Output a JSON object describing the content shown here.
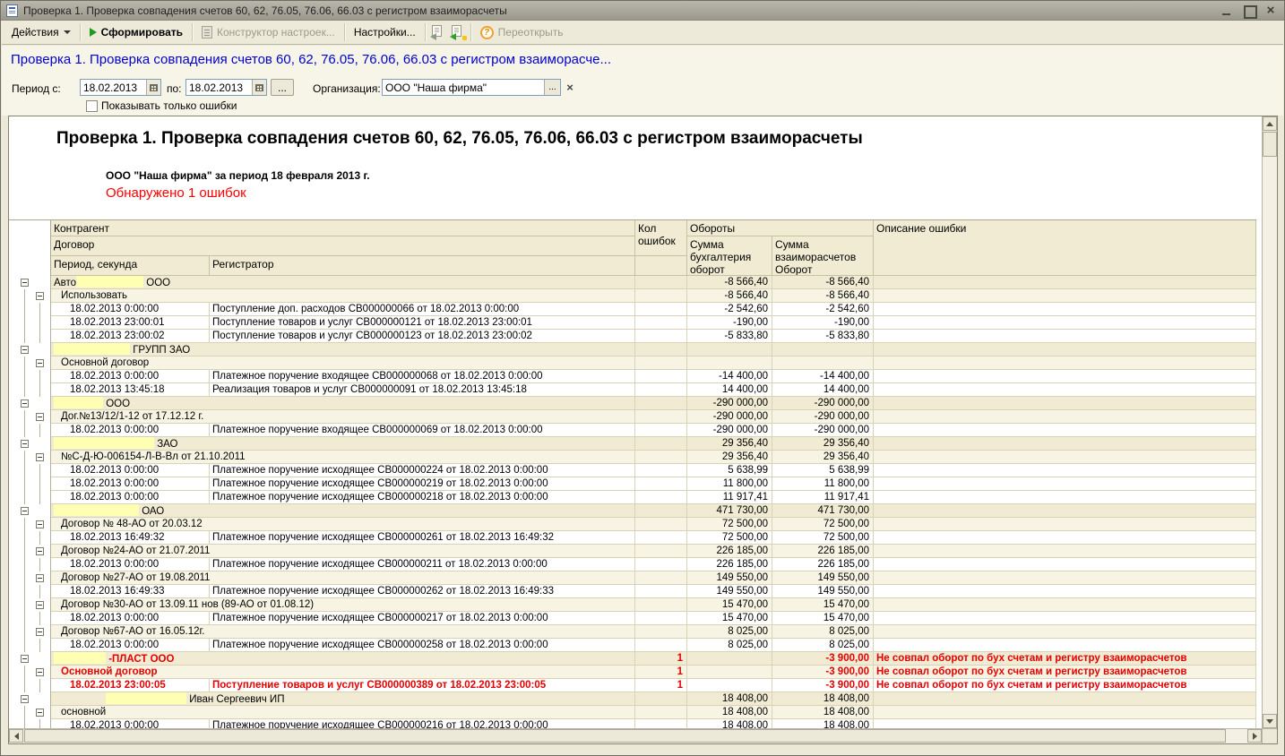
{
  "window": {
    "title": "Проверка 1. Проверка совпадения счетов 60, 62, 76.05, 76.06, 66.03  с регистром взаиморасчеты"
  },
  "toolbar": {
    "actions": "Действия",
    "generate": "Сформировать",
    "constructor": "Конструктор настроек...",
    "settings": "Настройки...",
    "help": "?",
    "reopen": "Переоткрыть"
  },
  "form": {
    "heading": "Проверка 1. Проверка совпадения счетов 60, 62, 76.05, 76.06, 66.03  с регистром взаиморасче...",
    "period_label": "Период с:",
    "period_from": "18.02.2013",
    "to_label": "по:",
    "period_to": "18.02.2013",
    "more_button": "...",
    "org_label": "Организация:",
    "org_value": "ООО \"Наша фирма\"",
    "org_more": "...",
    "org_clear": "×",
    "checkbox_label": "Показывать только ошибки",
    "checkbox_checked": false
  },
  "report": {
    "title": "Проверка 1. Проверка совпадения счетов 60, 62, 76.05, 76.06, 66.03  с регистром взаиморасчеты",
    "subtitle": "ООО \"Наша фирма\" за период 18 февраля 2013 г.",
    "error_summary": "Обнаружено 1 ошибок"
  },
  "colors": {
    "heading_blue": "#0000d4",
    "error_red": "#e60000",
    "highlight_yellow": "#ffffb4",
    "group1_bg": "#f0ebd2",
    "group2_bg": "#f7f4e3"
  },
  "table": {
    "headers": {
      "contragent": "Контрагент",
      "contract": "Договор",
      "period": "Период, секунда",
      "registrar": "Регистратор",
      "err_count": "Кол ошибок",
      "turnovers": "Обороты",
      "sum_accounting": "Сумма бухгалтерия оборот",
      "sum_settlements": "Сумма взаиморасчетов Оборот",
      "err_desc": "Описание ошибки"
    },
    "rows": [
      {
        "t": "g1",
        "l1": "box",
        "pre": "Авто",
        "hl": 75,
        "text": "ООО",
        "s1": "-8 566,40",
        "s2": "-8 566,40"
      },
      {
        "t": "g2",
        "l1": "line",
        "l2": "box",
        "text": "Использовать",
        "s1": "-8 566,40",
        "s2": "-8 566,40"
      },
      {
        "t": "d",
        "l1": "line",
        "l2": "line",
        "date": "18.02.2013 0:00:00",
        "reg": "Поступление доп. расходов СВ000000066 от 18.02.2013 0:00:00",
        "s1": "-2 542,60",
        "s2": "-2 542,60"
      },
      {
        "t": "d",
        "l1": "line",
        "l2": "line",
        "date": "18.02.2013 23:00:01",
        "reg": "Поступление товаров и услуг СВ000000121 от 18.02.2013 23:00:01",
        "s1": "-190,00",
        "s2": "-190,00"
      },
      {
        "t": "d",
        "l1": "line",
        "l2": "line",
        "date": "18.02.2013 23:00:02",
        "reg": "Поступление товаров и услуг СВ000000123 от 18.02.2013 23:00:02",
        "s1": "-5 833,80",
        "s2": "-5 833,80"
      },
      {
        "t": "g1",
        "l1": "box",
        "hl": 85,
        "text": "ГРУПП ЗАО",
        "s1": "",
        "s2": ""
      },
      {
        "t": "g2",
        "l1": "line",
        "l2": "box",
        "text": "Основной договор",
        "s1": "",
        "s2": ""
      },
      {
        "t": "d",
        "l1": "line",
        "l2": "line",
        "date": "18.02.2013 0:00:00",
        "reg": "Платежное поручение входящее СВ000000068 от 18.02.2013 0:00:00",
        "s1": "-14 400,00",
        "s2": "-14 400,00"
      },
      {
        "t": "d",
        "l1": "line",
        "l2": "line",
        "date": "18.02.2013 13:45:18",
        "reg": "Реализация товаров и услуг СВ000000091 от 18.02.2013 13:45:18",
        "s1": "14 400,00",
        "s2": "14 400,00"
      },
      {
        "t": "g1",
        "l1": "box",
        "hl": 55,
        "text": "ООО",
        "s1": "-290 000,00",
        "s2": "-290 000,00"
      },
      {
        "t": "g2",
        "l1": "line",
        "l2": "box",
        "text": "Дог.№13/12/1-12 от 17.12.12 г.",
        "s1": "-290 000,00",
        "s2": "-290 000,00"
      },
      {
        "t": "d",
        "l1": "line",
        "l2": "line",
        "date": "18.02.2013 0:00:00",
        "reg": "Платежное поручение входящее СВ000000069 от 18.02.2013 0:00:00",
        "s1": "-290 000,00",
        "s2": "-290 000,00"
      },
      {
        "t": "g1",
        "l1": "box",
        "hl": 112,
        "text": "ЗАО",
        "s1": "29 356,40",
        "s2": "29 356,40"
      },
      {
        "t": "g2",
        "l1": "line",
        "l2": "box",
        "text": "№С-Д-Ю-006154-Л-В-Вл от 21.10.2011",
        "s1": "29 356,40",
        "s2": "29 356,40"
      },
      {
        "t": "d",
        "l1": "line",
        "l2": "line",
        "date": "18.02.2013 0:00:00",
        "reg": "Платежное поручение исходящее СВ000000224 от 18.02.2013 0:00:00",
        "s1": "5 638,99",
        "s2": "5 638,99"
      },
      {
        "t": "d",
        "l1": "line",
        "l2": "line",
        "date": "18.02.2013 0:00:00",
        "reg": "Платежное поручение исходящее СВ000000219 от 18.02.2013 0:00:00",
        "s1": "11 800,00",
        "s2": "11 800,00"
      },
      {
        "t": "d",
        "l1": "line",
        "l2": "line",
        "date": "18.02.2013 0:00:00",
        "reg": "Платежное поручение исходящее СВ000000218 от 18.02.2013 0:00:00",
        "s1": "11 917,41",
        "s2": "11 917,41"
      },
      {
        "t": "g1",
        "l1": "box",
        "hl": 95,
        "text": "ОАО",
        "s1": "471 730,00",
        "s2": "471 730,00"
      },
      {
        "t": "g2",
        "l1": "line",
        "l2": "box",
        "text": "Договор № 48-АО от 20.03.12",
        "s1": "72 500,00",
        "s2": "72 500,00"
      },
      {
        "t": "d",
        "l1": "line",
        "l2": "line",
        "date": "18.02.2013 16:49:32",
        "reg": "Платежное поручение исходящее СВ000000261 от 18.02.2013 16:49:32",
        "s1": "72 500,00",
        "s2": "72 500,00"
      },
      {
        "t": "g2",
        "l1": "line",
        "l2": "box",
        "text": "Договор №24-АО от 21.07.2011",
        "s1": "226 185,00",
        "s2": "226 185,00"
      },
      {
        "t": "d",
        "l1": "line",
        "l2": "line",
        "date": "18.02.2013 0:00:00",
        "reg": "Платежное поручение исходящее СВ000000211 от 18.02.2013 0:00:00",
        "s1": "226 185,00",
        "s2": "226 185,00"
      },
      {
        "t": "g2",
        "l1": "line",
        "l2": "box",
        "text": "Договор №27-АО от 19.08.2011",
        "s1": "149 550,00",
        "s2": "149 550,00"
      },
      {
        "t": "d",
        "l1": "line",
        "l2": "line",
        "date": "18.02.2013 16:49:33",
        "reg": "Платежное поручение исходящее СВ000000262 от 18.02.2013 16:49:33",
        "s1": "149 550,00",
        "s2": "149 550,00"
      },
      {
        "t": "g2",
        "l1": "line",
        "l2": "box",
        "text": "Договор №30-АО от 13.09.11 нов (89-АО от 01.08.12)",
        "s1": "15 470,00",
        "s2": "15 470,00"
      },
      {
        "t": "d",
        "l1": "line",
        "l2": "line",
        "date": "18.02.2013 0:00:00",
        "reg": "Платежное поручение исходящее СВ000000217 от 18.02.2013 0:00:00",
        "s1": "15 470,00",
        "s2": "15 470,00"
      },
      {
        "t": "g2",
        "l1": "line",
        "l2": "box",
        "text": "Договор №67-АО от 16.05.12г.",
        "s1": "8 025,00",
        "s2": "8 025,00"
      },
      {
        "t": "d",
        "l1": "line",
        "l2": "line",
        "date": "18.02.2013 0:00:00",
        "reg": "Платежное поручение исходящее СВ000000258 от 18.02.2013 0:00:00",
        "s1": "8 025,00",
        "s2": "8 025,00"
      },
      {
        "t": "g1",
        "l1": "box",
        "hl": 58,
        "text": "-ПЛАСТ ООО",
        "red": true,
        "kol": "1",
        "s1": "",
        "s2": "-3 900,00",
        "desc": "Не совпал оборот по бух счетам и регистру взаиморасчетов"
      },
      {
        "t": "g2",
        "l1": "line",
        "l2": "box",
        "text": "Основной договор",
        "red": true,
        "kol": "1",
        "s1": "",
        "s2": "-3 900,00",
        "desc": "Не совпал оборот по бух счетам и регистру взаиморасчетов"
      },
      {
        "t": "d",
        "l1": "line",
        "l2": "line",
        "date": "18.02.2013 23:00:05",
        "reg": "Поступление товаров и услуг СВ000000389 от 18.02.2013 23:00:05",
        "red": true,
        "kol": "1",
        "s1": "",
        "s2": "-3 900,00",
        "desc": "Не совпал оборот по бух счетам и регистру взаиморасчетов"
      },
      {
        "t": "g1",
        "l1": "box",
        "ind": 58,
        "hl": 90,
        "text": "Иван Сергеевич ИП",
        "s1": "18 408,00",
        "s2": "18 408,00"
      },
      {
        "t": "g2",
        "l1": "line",
        "l2": "box",
        "text": "основной",
        "s1": "18 408,00",
        "s2": "18 408,00"
      },
      {
        "t": "d",
        "l1": "line",
        "l2": "line",
        "date": "18.02.2013 0:00:00",
        "reg": "Платежное поручение исходящее СВ000000216 от 18.02.2013 0:00:00",
        "s1": "18 408,00",
        "s2": "18 408,00"
      }
    ]
  }
}
